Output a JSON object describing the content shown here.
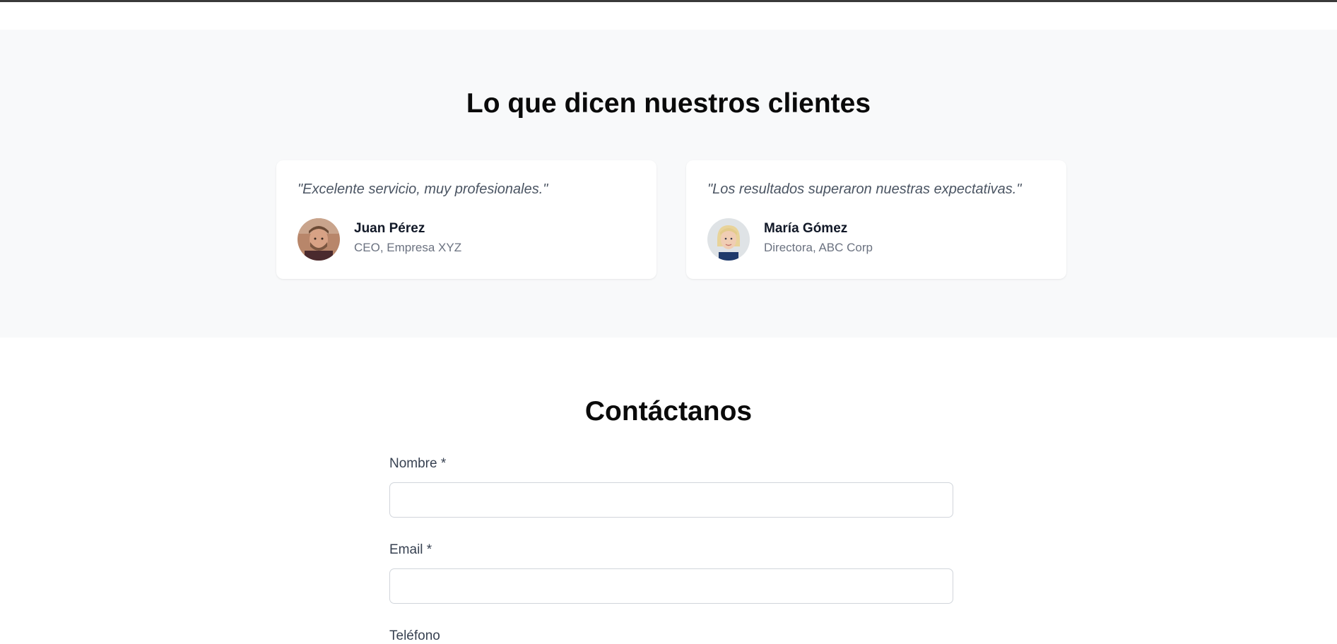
{
  "testimonials": {
    "title": "Lo que dicen nuestros clientes",
    "items": [
      {
        "quote": "\"Excelente servicio, muy profesionales.\"",
        "name": "Juan Pérez",
        "role": "CEO, Empresa XYZ"
      },
      {
        "quote": "\"Los resultados superaron nuestras expectativas.\"",
        "name": "María Gómez",
        "role": "Directora, ABC Corp"
      }
    ]
  },
  "contact": {
    "title": "Contáctanos",
    "fields": [
      {
        "label": "Nombre *",
        "value": ""
      },
      {
        "label": "Email *",
        "value": ""
      },
      {
        "label": "Teléfono"
      }
    ]
  },
  "colors": {
    "section_bg": "#f8f9fa",
    "card_bg": "#ffffff",
    "text_dark": "#111827",
    "text_muted": "#6b7280",
    "input_border": "#d1d5db"
  }
}
